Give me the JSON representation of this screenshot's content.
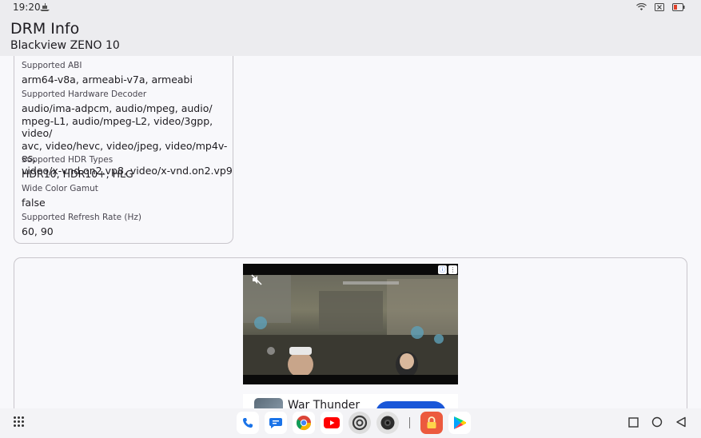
{
  "status": {
    "time": "19:20"
  },
  "app": {
    "title": "DRM Info",
    "subtitle": "Blackview ZENO 10"
  },
  "card": {
    "fields": [
      {
        "label": "Supported ABI",
        "value": "arm64-v8a, armeabi-v7a, armeabi"
      },
      {
        "label": "Supported Hardware Decoder",
        "value": "audio/ima-adpcm, audio/mpeg, audio/\nmpeg-L1, audio/mpeg-L2, video/3gpp, video/\navc, video/hevc, video/jpeg, video/mp4v-es,\nvideo/x-vnd.on2.vp8, video/x-vnd.on2.vp9"
      },
      {
        "label": "Supported HDR Types",
        "value": "HDR10, HDR10+, HLG"
      },
      {
        "label": "Wide Color Gamut",
        "value": "false"
      },
      {
        "label": "Supported Refresh Rate (Hz)",
        "value": "60, 90"
      }
    ]
  },
  "ad": {
    "app_name": "War Thunder"
  },
  "colors": {
    "accent": "#1a57d8",
    "card_border": "#c9c6cc",
    "background": "#f8f8fb"
  }
}
